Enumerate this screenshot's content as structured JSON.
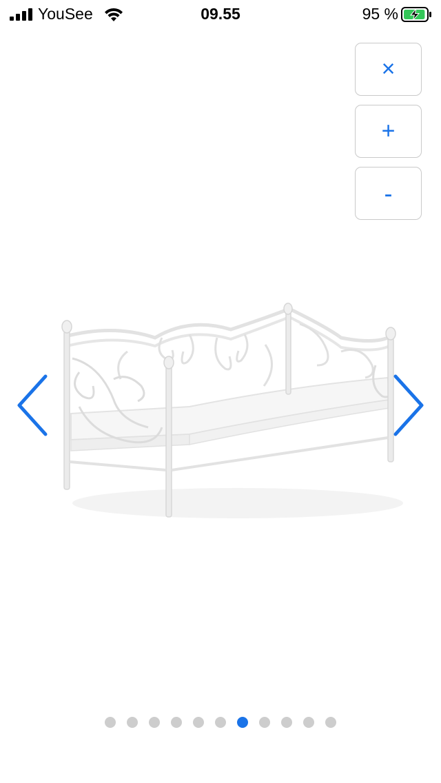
{
  "status_bar": {
    "carrier": "YouSee",
    "time": "09.55",
    "battery_percent": "95 %",
    "battery_level": 0.95,
    "charging": true
  },
  "controls": {
    "close_label": "×",
    "zoom_in_label": "+",
    "zoom_out_label": "-"
  },
  "gallery": {
    "total_images": 11,
    "active_index": 6
  },
  "colors": {
    "accent": "#1a73e8",
    "dot_inactive": "#cdcdcd",
    "battery_green": "#34c759"
  },
  "icons": {
    "prev": "chevron-left-icon",
    "next": "chevron-right-icon",
    "signal": "cellular-signal-icon",
    "wifi": "wifi-icon",
    "battery": "battery-charging-icon"
  }
}
